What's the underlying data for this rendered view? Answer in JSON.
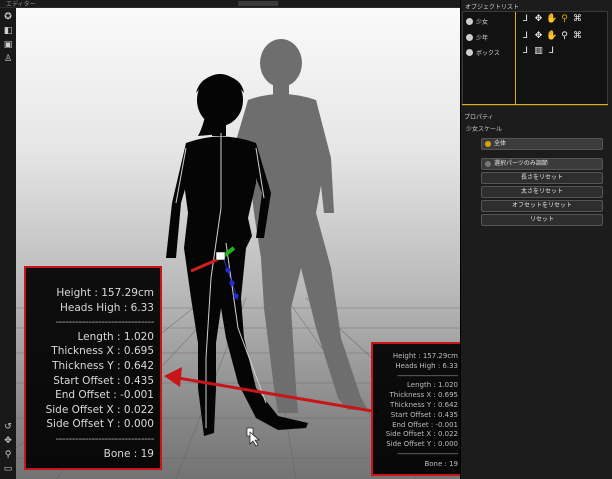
{
  "app": {
    "window_title": "エディター",
    "object_list_title": "オブジェクトリスト",
    "property_title": "プロパティ"
  },
  "left_tools": [
    "rotate-view-icon",
    "cube-icon",
    "layers-icon",
    "figure-icon",
    "undo-icon",
    "move-icon",
    "zoom-icon",
    "frame-icon"
  ],
  "object_list": [
    {
      "name": "少女",
      "icons": [
        "⅃",
        "✥",
        "✋",
        "⚲",
        "⌘"
      ]
    },
    {
      "name": "少年",
      "icons": [
        "⅃",
        "✥",
        "✋",
        "⚲",
        "⌘"
      ]
    },
    {
      "name": "ボックス",
      "icons": [
        "⅃",
        "▥",
        "⅃"
      ]
    }
  ],
  "property_panel": {
    "section": "少女スケール",
    "radio_all": "全体",
    "radio_selected": "選択パーツのみ調節",
    "buttons": [
      "長さをリセット",
      "太さをリセット",
      "オフセットをリセット",
      "リセット"
    ]
  },
  "bone_info_large": {
    "height": "Height : 157.29cm",
    "heads_high": "Heads High : 6.33",
    "separator": "------------------------------",
    "length": "Length : 1.020",
    "thickness_x": "Thickness X : 0.695",
    "thickness_y": "Thickness Y : 0.642",
    "start_offset": "Start Offset : 0.435",
    "end_offset": "End Offset : -0.001",
    "side_offset_x": "Side Offset X : 0.022",
    "side_offset_y": "Side Offset Y : 0.000",
    "separator2": "------------------------------",
    "bone": "Bone : 19"
  },
  "bone_info_small": {
    "height": "Height : 157.29cm",
    "heads_high": "Heads High : 6.33",
    "separator": "------------------------------",
    "length": "Length : 1.020",
    "thickness_x": "Thickness X : 0.695",
    "thickness_y": "Thickness Y : 0.642",
    "start_offset": "Start Offset : 0.435",
    "end_offset": "End Offset : -0.001",
    "side_offset_x": "Side Offset X : 0.022",
    "side_offset_y": "Side Offset Y : 0.000",
    "separator2": "------------------------------",
    "bone": "Bone : 19"
  },
  "colors": {
    "annotation_red": "#c8151a",
    "accent_gold": "#e0b000",
    "gizmo_red": "#d22020",
    "gizmo_green": "#1fb31f",
    "gizmo_blue": "#2030d0"
  }
}
